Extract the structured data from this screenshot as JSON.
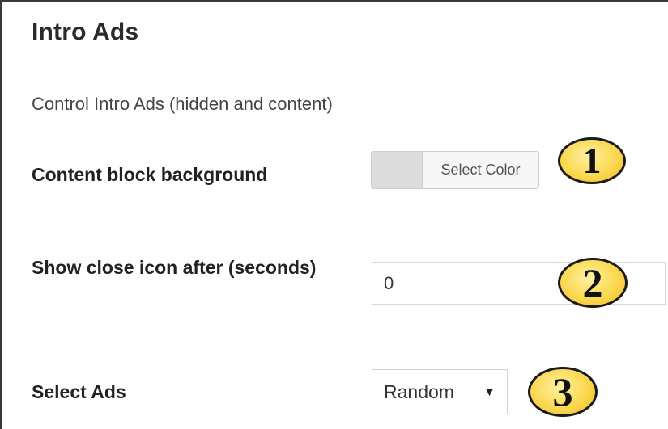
{
  "section": {
    "title": "Intro Ads",
    "description": "Control Intro Ads (hidden and content)"
  },
  "fields": {
    "content_block_background": {
      "label": "Content block background",
      "button_label": "Select Color",
      "swatch_color": "#dcdcdc"
    },
    "close_icon_delay": {
      "label": "Show close icon after (seconds)",
      "value": "0"
    },
    "select_ads": {
      "label": "Select Ads",
      "selected": "Random",
      "arrow": "▼"
    }
  },
  "badges": [
    "1",
    "2",
    "3"
  ],
  "colors": {
    "badge_fill": "#fbd84f",
    "badge_border": "#1a1a1a"
  }
}
